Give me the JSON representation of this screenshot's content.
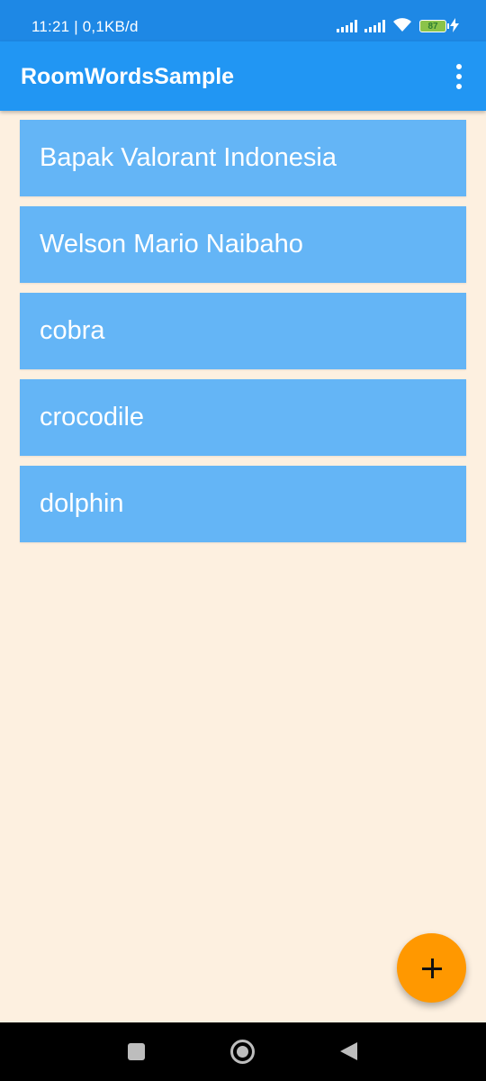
{
  "status_bar": {
    "time_data": "11:21 | 0,1KB/d",
    "battery_level": "87",
    "icons": [
      "signal-icon",
      "signal-icon",
      "wifi-icon",
      "battery-icon",
      "charging-icon"
    ]
  },
  "app_bar": {
    "title": "RoomWordsSample",
    "menu_icon": "more-vert-icon"
  },
  "words": [
    {
      "label": "Bapak Valorant Indonesia"
    },
    {
      "label": "Welson Mario Naibaho"
    },
    {
      "label": "cobra"
    },
    {
      "label": "crocodile"
    },
    {
      "label": "dolphin"
    }
  ],
  "fab": {
    "icon": "plus-icon"
  },
  "nav_bar": {
    "icons": [
      "recents-icon",
      "home-icon",
      "back-icon"
    ]
  },
  "colors": {
    "status_bar": "#1E88E5",
    "app_bar": "#2196F3",
    "list_item": "#64B5F6",
    "background": "#FDF0E0",
    "fab": "#FF9800"
  }
}
